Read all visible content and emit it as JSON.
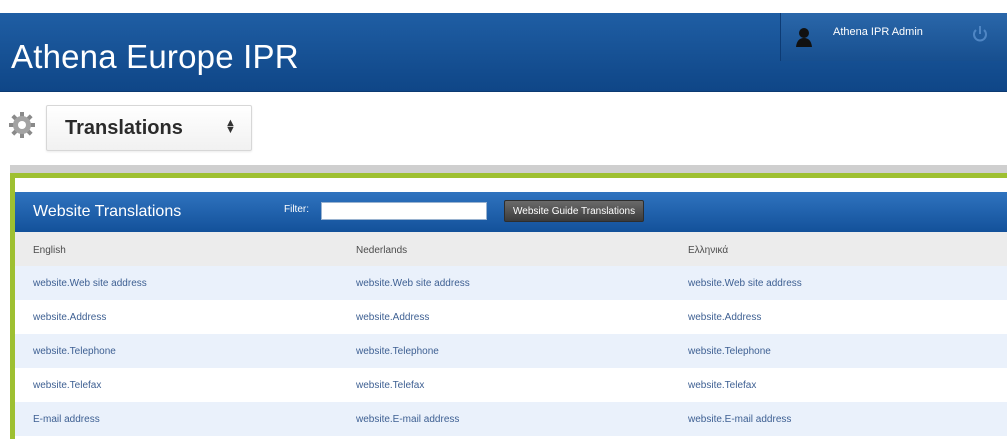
{
  "app": {
    "title": "Athena Europe IPR"
  },
  "user": {
    "name": "Athena IPR Admin"
  },
  "page": {
    "title": "Translations"
  },
  "panel": {
    "title": "Website Translations",
    "filter_label": "Filter:",
    "filter_value": "",
    "guide_button": "Website Guide Translations"
  },
  "table": {
    "columns": [
      "English",
      "Nederlands",
      "Ελληνικά"
    ],
    "rows": [
      [
        "website.Web site address",
        "website.Web site address",
        "website.Web site address"
      ],
      [
        "website.Address",
        "website.Address",
        "website.Address"
      ],
      [
        "website.Telephone",
        "website.Telephone",
        "website.Telephone"
      ],
      [
        "website.Telefax",
        "website.Telefax",
        "website.Telefax"
      ],
      [
        "E-mail address",
        "website.E-mail address",
        "website.E-mail address"
      ]
    ]
  },
  "colors": {
    "header_blue": "#13519a",
    "accent_green": "#9ec031",
    "row_alt": "#eaf1fb"
  }
}
